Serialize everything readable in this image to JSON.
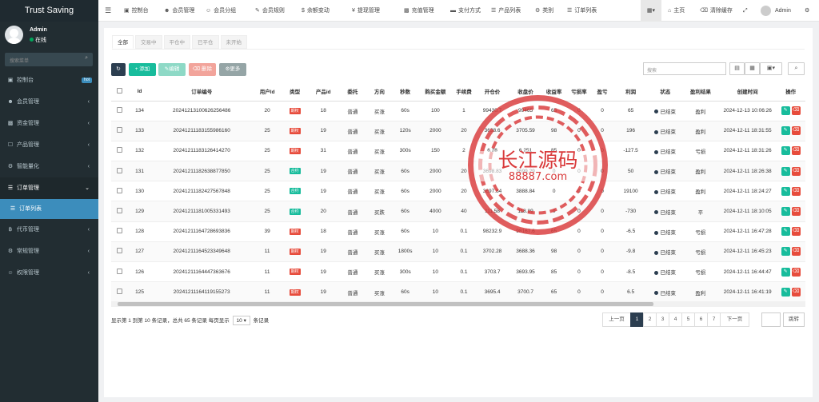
{
  "app": {
    "title": "Trust Saving"
  },
  "user": {
    "name": "Admin",
    "status": "在线"
  },
  "sidebar": {
    "search_placeholder": "搜索菜单",
    "items": [
      {
        "label": "控制台",
        "icon": "dashboard-icon",
        "badge": "hot"
      },
      {
        "label": "会员管理",
        "icon": "user-icon"
      },
      {
        "label": "资金管理",
        "icon": "wallet-icon"
      },
      {
        "label": "产品管理",
        "icon": "box-icon"
      },
      {
        "label": "智能量化",
        "icon": "robot-icon"
      },
      {
        "label": "订单管理",
        "icon": "list-icon"
      },
      {
        "label": "订单列表",
        "icon": "list-icon"
      },
      {
        "label": "代币管理",
        "icon": "bitcoin-icon"
      },
      {
        "label": "常规管理",
        "icon": "gear-icon"
      },
      {
        "label": "权限管理",
        "icon": "group-icon"
      }
    ]
  },
  "topnav": {
    "items": [
      "控制台",
      "会员管理",
      "会员分组",
      "会员规则",
      "余额变动",
      "提现管理",
      "充值管理",
      "支付方式",
      "产品列表",
      "类别",
      "订单列表"
    ],
    "right": {
      "home": "主页",
      "clear_cache": "清除缓存",
      "user": "Admin"
    }
  },
  "tabs": [
    "全部",
    "交易中",
    "平仓中",
    "已平仓",
    "未开始"
  ],
  "toolbar": {
    "add": "添加",
    "edit": "编辑",
    "delete": "删除",
    "more": "更多",
    "search_placeholder": "搜索"
  },
  "table": {
    "headers": [
      "Id",
      "订单编号",
      "用户Id",
      "类型",
      "产品id",
      "委托",
      "方向",
      "秒数",
      "购买金额",
      "手续费",
      "开仓价",
      "收盘价",
      "收益率",
      "亏损率",
      "盈亏",
      "利润",
      "状态",
      "盈利结果",
      "创建时间",
      "操作"
    ],
    "rows": [
      {
        "id": "134",
        "no": "2024121310062625648​6",
        "uid": "20",
        "type": "期权",
        "type_color": "#e74c3c",
        "pid": "18",
        "entrust": "普通",
        "dir": "买涨",
        "dir_green": false,
        "sec": "60s",
        "amount": "100",
        "fee": "1",
        "open": "99430.7",
        "close": "99465",
        "rate": "65",
        "loss": "0",
        "pl": "0",
        "profit": "65",
        "status": "已结束",
        "result": "盈利",
        "result_green": true,
        "time": "2024-12-13 10:06:26"
      },
      {
        "id": "133",
        "no": "20241211183155986160",
        "uid": "25",
        "type": "期权",
        "type_color": "#e74c3c",
        "pid": "19",
        "entrust": "普通",
        "dir": "买涨",
        "dir_green": false,
        "sec": "120s",
        "amount": "2000",
        "fee": "20",
        "open": "3638.6",
        "close": "3705.59",
        "rate": "98",
        "loss": "0",
        "pl": "0",
        "profit": "196",
        "status": "已结束",
        "result": "盈利",
        "result_green": true,
        "time": "2024-12-11 18:31:55"
      },
      {
        "id": "132",
        "no": "20241211183126414270",
        "uid": "25",
        "type": "期权",
        "type_color": "#e74c3c",
        "pid": "31",
        "entrust": "普通",
        "dir": "买涨",
        "dir_green": false,
        "sec": "300s",
        "amount": "150",
        "fee": "2",
        "open": "6.28",
        "close": "6.251",
        "rate": "85",
        "loss": "0",
        "pl": "0",
        "profit": "-127.5",
        "status": "已结束",
        "result": "亏损",
        "result_green": false,
        "time": "2024-12-11 18:31:26"
      },
      {
        "id": "131",
        "no": "20241211182638877850",
        "uid": "25",
        "type": "合约",
        "type_color": "#18bc9c",
        "pid": "19",
        "entrust": "普通",
        "dir": "买涨",
        "dir_green": false,
        "sec": "60s",
        "amount": "2000",
        "fee": "20",
        "open": "3698.83",
        "close": "3699.29",
        "rate": "0",
        "loss": "0",
        "pl": "0",
        "profit": "50",
        "status": "已结束",
        "result": "盈利",
        "result_green": true,
        "time": "2024-12-11 18:26:38"
      },
      {
        "id": "130",
        "no": "20241211182427567848",
        "uid": "25",
        "type": "合约",
        "type_color": "#18bc9c",
        "pid": "19",
        "entrust": "普通",
        "dir": "买涨",
        "dir_green": false,
        "sec": "60s",
        "amount": "2000",
        "fee": "20",
        "open": "3697.84",
        "close": "3888.84",
        "rate": "0",
        "loss": "0",
        "pl": "0",
        "profit": "19100",
        "status": "已结束",
        "result": "盈利",
        "result_green": true,
        "time": "2024-12-11 18:24:27"
      },
      {
        "id": "129",
        "no": "20241211181005331493",
        "uid": "25",
        "type": "合约",
        "type_color": "#18bc9c",
        "pid": "20",
        "entrust": "普通",
        "dir": "买跌",
        "dir_green": true,
        "sec": "60s",
        "amount": "4000",
        "fee": "40",
        "open": "111.58",
        "close": "118.89",
        "rate": "0",
        "loss": "0",
        "pl": "0",
        "profit": "-730",
        "status": "已结束",
        "result": "平",
        "result_green": null,
        "time": "2024-12-11 18:10:05"
      },
      {
        "id": "128",
        "no": "20241211164728693836",
        "uid": "39",
        "type": "期权",
        "type_color": "#e74c3c",
        "pid": "18",
        "entrust": "普通",
        "dir": "买涨",
        "dir_green": false,
        "sec": "60s",
        "amount": "10",
        "fee": "0.1",
        "open": "98232.9",
        "close": "98167.6",
        "rate": "65",
        "loss": "0",
        "pl": "0",
        "profit": "-6.5",
        "status": "已结束",
        "result": "亏损",
        "result_green": false,
        "time": "2024-12-11 16:47:28"
      },
      {
        "id": "127",
        "no": "20241211164523349648",
        "uid": "11",
        "type": "期权",
        "type_color": "#e74c3c",
        "pid": "19",
        "entrust": "普通",
        "dir": "买涨",
        "dir_green": false,
        "sec": "1800s",
        "amount": "10",
        "fee": "0.1",
        "open": "3702.28",
        "close": "3688.36",
        "rate": "98",
        "loss": "0",
        "pl": "0",
        "profit": "-9.8",
        "status": "已结束",
        "result": "亏损",
        "result_green": false,
        "time": "2024-12-11 16:45:23"
      },
      {
        "id": "126",
        "no": "20241211164447363676",
        "uid": "11",
        "type": "期权",
        "type_color": "#e74c3c",
        "pid": "19",
        "entrust": "普通",
        "dir": "买涨",
        "dir_green": false,
        "sec": "300s",
        "amount": "10",
        "fee": "0.1",
        "open": "3703.7",
        "close": "3693.95",
        "rate": "85",
        "loss": "0",
        "pl": "0",
        "profit": "-8.5",
        "status": "已结束",
        "result": "亏损",
        "result_green": false,
        "time": "2024-12-11 16:44:47"
      },
      {
        "id": "125",
        "no": "20241211164119155273",
        "uid": "11",
        "type": "期权",
        "type_color": "#e74c3c",
        "pid": "19",
        "entrust": "普通",
        "dir": "买涨",
        "dir_green": false,
        "sec": "60s",
        "amount": "10",
        "fee": "0.1",
        "open": "3695.4",
        "close": "3700.7",
        "rate": "65",
        "loss": "0",
        "pl": "0",
        "profit": "6.5",
        "status": "已结束",
        "result": "盈利",
        "result_green": true,
        "time": "2024-12-11 16:41:19"
      }
    ]
  },
  "pagination": {
    "info_a": "显示第 1 到第 10 条记录，总共 65 条记录 每页显示",
    "page_size": "10",
    "info_b": "条记录",
    "prev": "上一页",
    "pages": [
      "1",
      "2",
      "3",
      "4",
      "5",
      "6",
      "7"
    ],
    "next": "下一页",
    "jump": "跳转"
  },
  "watermark": {
    "text": "长江源码",
    "url": "88887.com"
  }
}
